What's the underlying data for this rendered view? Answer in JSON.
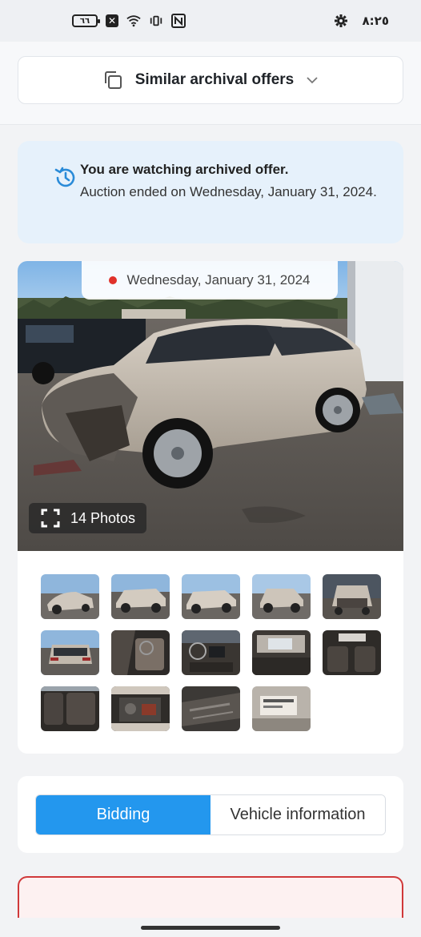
{
  "status_bar": {
    "time": "٨:٢٥",
    "battery": "٦٦",
    "icons": [
      "battery-icon",
      "notification-x-icon",
      "wifi-icon",
      "vibrate-icon",
      "nfc-icon",
      "settings-gear-icon"
    ]
  },
  "similar_offers": {
    "label": "Similar archival offers",
    "icon": "copy-icon",
    "chevron": "chevron-down-icon"
  },
  "notice": {
    "icon": "history-icon",
    "title": "You are watching archived offer.",
    "text": "Auction ended on Wednesday, January 31, 2024.",
    "accent": "#2a8bd8"
  },
  "gallery": {
    "date": "Wednesday, January 31, 2024",
    "photos_label": "14 Photos",
    "thumbnails": [
      "front-left",
      "left-side",
      "right-side",
      "rear-right",
      "front",
      "rear",
      "driver-interior",
      "dashboard",
      "interior-roof",
      "rear-seats",
      "rear-seats-side",
      "engine-bay",
      "undercarriage",
      "label-sticker"
    ]
  },
  "tabs": {
    "items": [
      "Bidding",
      "Vehicle information"
    ],
    "active": "Bidding",
    "accent": "#2397ee"
  }
}
